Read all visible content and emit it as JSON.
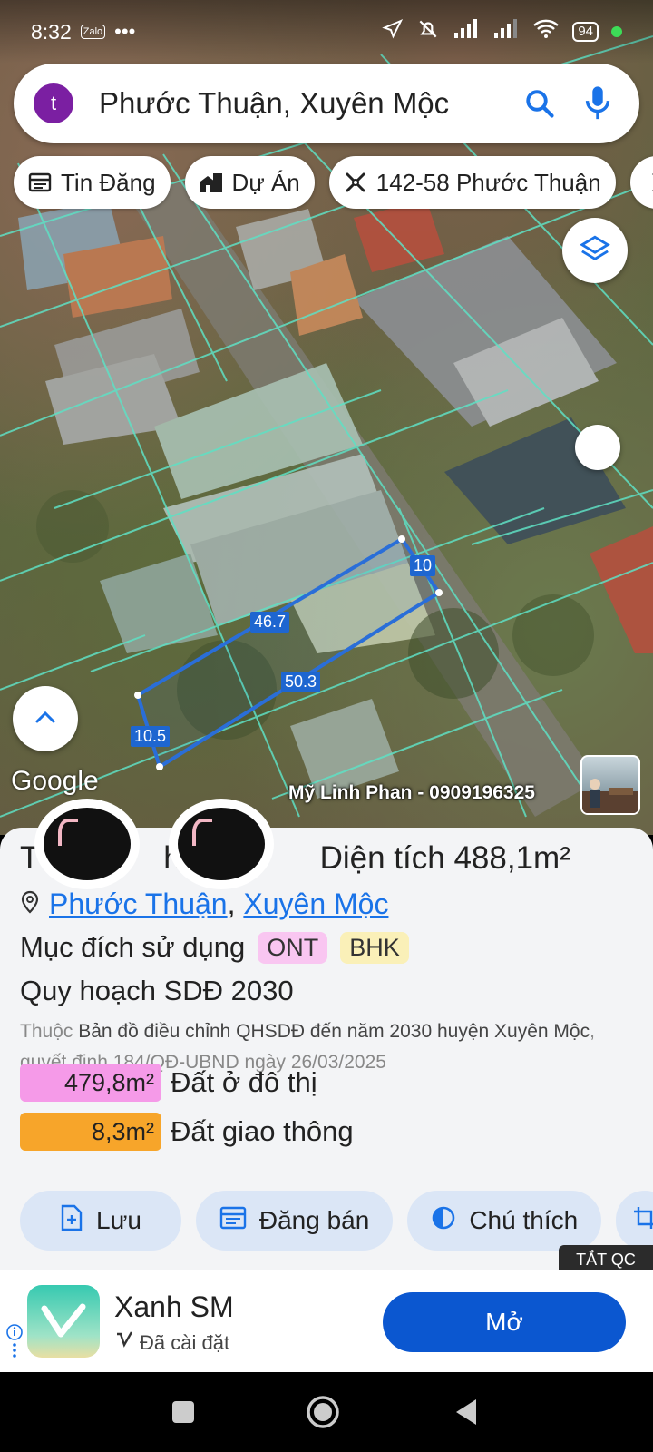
{
  "status_bar": {
    "time": "8:32",
    "app_indicator": "Zalo",
    "more": "•••",
    "battery": "94",
    "signal": "6"
  },
  "search": {
    "avatar_letter": "t",
    "query": "Phước Thuận, Xuyên Mộc"
  },
  "chips": [
    {
      "label": "Tin Đăng",
      "icon": "listing-icon"
    },
    {
      "label": "Dự Án",
      "icon": "building-icon"
    },
    {
      "label": "142-58 Phước Thuận",
      "icon": "ruler-icon"
    }
  ],
  "map": {
    "dimensions": {
      "top": "10",
      "side_right": "46.7",
      "bottom": "50.3",
      "left": "10.5"
    },
    "google_logo": "Google",
    "watermark": "Mỹ Linh Phan - 0909196325"
  },
  "sheet": {
    "title_prefix": "T",
    "title_mid": "hử",
    "title_area_label": "Diện tích",
    "area_value": "488,1m²",
    "location": {
      "commune": "Phước Thuận",
      "separator": ",",
      "district": "Xuyên Mộc"
    },
    "purpose_label": "Mục đích sử dụng",
    "tags": [
      "ONT",
      "BHK"
    ],
    "plan_title": "Quy hoạch SDĐ 2030",
    "plan_desc": {
      "prefix": "Thuộc",
      "map_name": "Bản đồ điều chỉnh QHSDĐ đến năm 2030 huyện Xuyên Mộc",
      "decision": ", quyết định 184/QĐ-UBND ngày 26/03/2025"
    },
    "land_uses": [
      {
        "amount": "479,8m²",
        "label": "Đất ở đô thị",
        "color": "#f59ae8"
      },
      {
        "amount": "8,3m²",
        "label": "Đất giao thông",
        "color": "#f7a52a"
      }
    ],
    "actions": [
      {
        "label": "Lưu",
        "icon": "add-doc-icon"
      },
      {
        "label": "Đăng bán",
        "icon": "calendar-list-icon"
      },
      {
        "label": "Chú thích",
        "icon": "contrast-icon"
      }
    ]
  },
  "ad": {
    "close_label": "TẮT QC",
    "app_name": "Xanh SM",
    "installed": "Đã cài đặt",
    "open_label": "Mở"
  }
}
